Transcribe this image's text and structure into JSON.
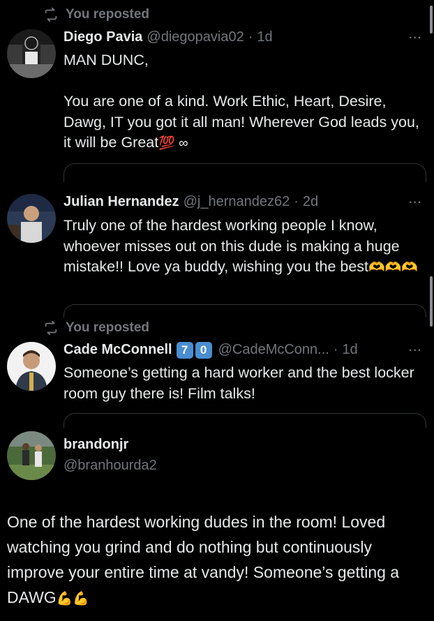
{
  "posts": [
    {
      "repost_label": "You reposted",
      "name": "Diego Pavia",
      "handle": "@diegopavia02",
      "sep": "·",
      "time": "1d",
      "more": "···",
      "text": "MAN DUNC,\n\nYou are one of a kind. Work Ethic, Heart, Desire, Dawg, IT you got it all man! Wherever God leads you, it will be Great",
      "emoji": "💯 ∞"
    },
    {
      "name": "Julian Hernandez",
      "handle": "@j_hernandez62",
      "sep": "·",
      "time": "2d",
      "more": "···",
      "text": "Truly one of the hardest working people I know, whoever misses out on this dude is making a huge mistake!! Love ya buddy, wishing you the best",
      "emoji": "🫶🫶🫶"
    },
    {
      "repost_label": "You reposted",
      "name": "Cade McConnell",
      "badge1": "7",
      "badge2": "0",
      "handle": "@CadeMcConn...",
      "sep": "·",
      "time": "1d",
      "more": "···",
      "text": "Someone’s getting a hard worker and the best locker room guy there is! Film talks!"
    },
    {
      "name": "brandonjr",
      "handle": "@branhourda2",
      "text": "One of the hardest working dudes in the room! Loved watching you grind and do nothing but continuously improve your entire time at vandy! Someone’s getting a DAWG",
      "emoji": "💪💪"
    }
  ],
  "colors": {
    "background": "#000000",
    "text": "#e7e9ea",
    "muted": "#71767b",
    "border": "#2f3336",
    "badge": "#4a8ed0"
  },
  "icons": [
    "repost-icon",
    "more-icon",
    "avatar"
  ]
}
